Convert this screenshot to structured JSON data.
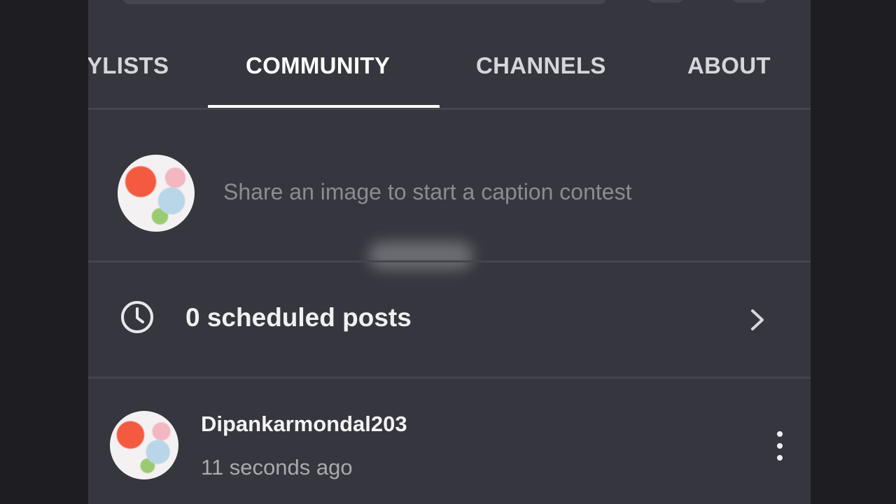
{
  "tabs": [
    {
      "label": "YLISTS",
      "active": false
    },
    {
      "label": "COMMUNITY",
      "active": true
    },
    {
      "label": "CHANNELS",
      "active": false
    },
    {
      "label": "ABOUT",
      "active": false
    }
  ],
  "composer": {
    "placeholder": "Share an image to start a caption contest",
    "avatar_icon": "channel-avatar"
  },
  "scheduled": {
    "label": "0 scheduled posts",
    "icon": "clock-icon",
    "chevron": "chevron-right-icon"
  },
  "post": {
    "author": "Dipankarmondal203",
    "time": "11 seconds ago",
    "menu_icon": "more-vert-icon"
  },
  "colors": {
    "background": "#36363e",
    "outer": "#1e1e22",
    "text": "#f0f0f2",
    "muted": "#8b8b92",
    "divider": "#45454e"
  }
}
